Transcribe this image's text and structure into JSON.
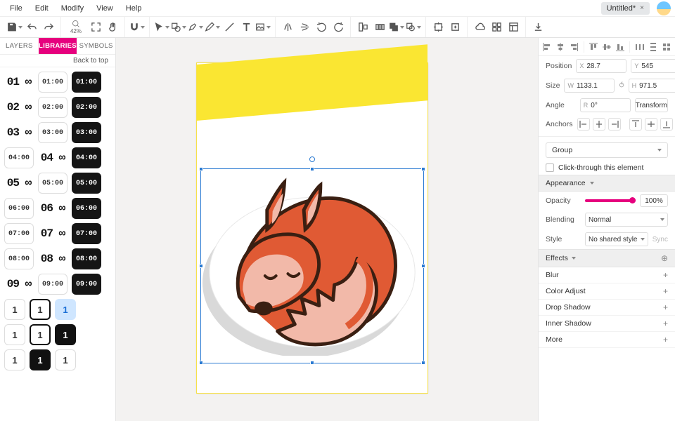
{
  "menubar": {
    "items": [
      "File",
      "Edit",
      "Modify",
      "View",
      "Help"
    ]
  },
  "document_tab": {
    "title": "Untitled*",
    "close_glyph": "×"
  },
  "toolbar": {
    "zoom_value": "42%"
  },
  "left_panel": {
    "tabs": {
      "layers": "LAYERS",
      "libraries": "LIBRARIES",
      "symbols": "SYMBOLS"
    },
    "back_to_top": "Back to top",
    "rows": [
      {
        "txt": "01 ∞",
        "outline": "01:00",
        "inverse": "01:00"
      },
      {
        "txt": "02 ∞",
        "outline": "02:00",
        "inverse": "02:00"
      },
      {
        "txt": "03 ∞",
        "outline": "03:00",
        "inverse": "03:00"
      },
      {
        "outline": "04:00",
        "txt": "04 ∞",
        "inverse": "04:00"
      },
      {
        "txt": "05 ∞",
        "outline": "05:00",
        "inverse": "05:00"
      },
      {
        "outline": "06:00",
        "txt": "06 ∞",
        "inverse": "06:00"
      },
      {
        "outline": "07:00",
        "txt": "07 ∞",
        "inverse": "07:00"
      },
      {
        "outline": "08:00",
        "txt": "08 ∞",
        "inverse": "08:00"
      },
      {
        "txt": "09 ∞",
        "outline": "09:00",
        "inverse": "09:00"
      }
    ],
    "ones": [
      "1",
      "1",
      "1",
      "1",
      "1",
      "1",
      "1",
      "1",
      "1"
    ]
  },
  "inspector": {
    "position": {
      "label": "Position",
      "x_prefix": "X",
      "x_value": "28.7",
      "y_prefix": "Y",
      "y_value": "545"
    },
    "size": {
      "label": "Size",
      "w_prefix": "W",
      "w_value": "1133.1",
      "h_prefix": "H",
      "h_value": "971.5"
    },
    "angle": {
      "label": "Angle",
      "r_prefix": "R",
      "r_value": "0°",
      "transform_btn": "Transform"
    },
    "anchors": {
      "label": "Anchors"
    },
    "group_select": "Group",
    "click_through": "Click-through this element",
    "appearance": {
      "title": "Appearance",
      "opacity_label": "Opacity",
      "opacity_value": "100%",
      "blending_label": "Blending",
      "blending_value": "Normal",
      "style_label": "Style",
      "style_value": "No shared style",
      "sync": "Sync"
    },
    "effects": {
      "title": "Effects",
      "items": [
        "Blur",
        "Color Adjust",
        "Drop Shadow",
        "Inner Shadow",
        "More"
      ]
    }
  }
}
